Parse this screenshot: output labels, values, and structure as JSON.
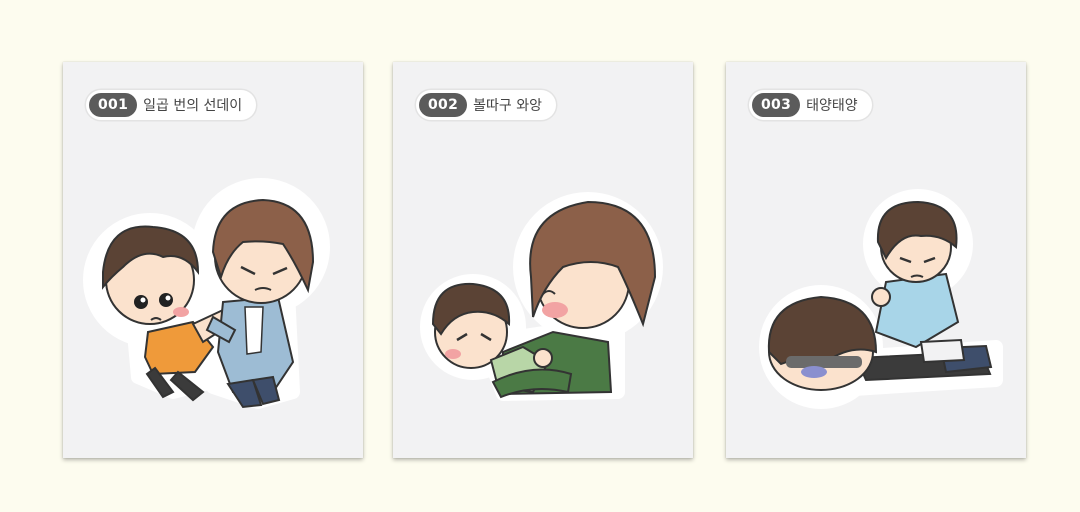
{
  "stickers": [
    {
      "number": "001",
      "title": "일곱 번의 선데이"
    },
    {
      "number": "002",
      "title": "볼따구 와앙"
    },
    {
      "number": "003",
      "title": "태양태양"
    }
  ],
  "colors": {
    "page_background": "#fdfcef",
    "card_background": "#f2f2f3",
    "tag_number_background": "#5b5b5b",
    "hair_brown": "#8c6049",
    "hair_dark": "#5b4335",
    "skin": "#fbe2cd"
  }
}
